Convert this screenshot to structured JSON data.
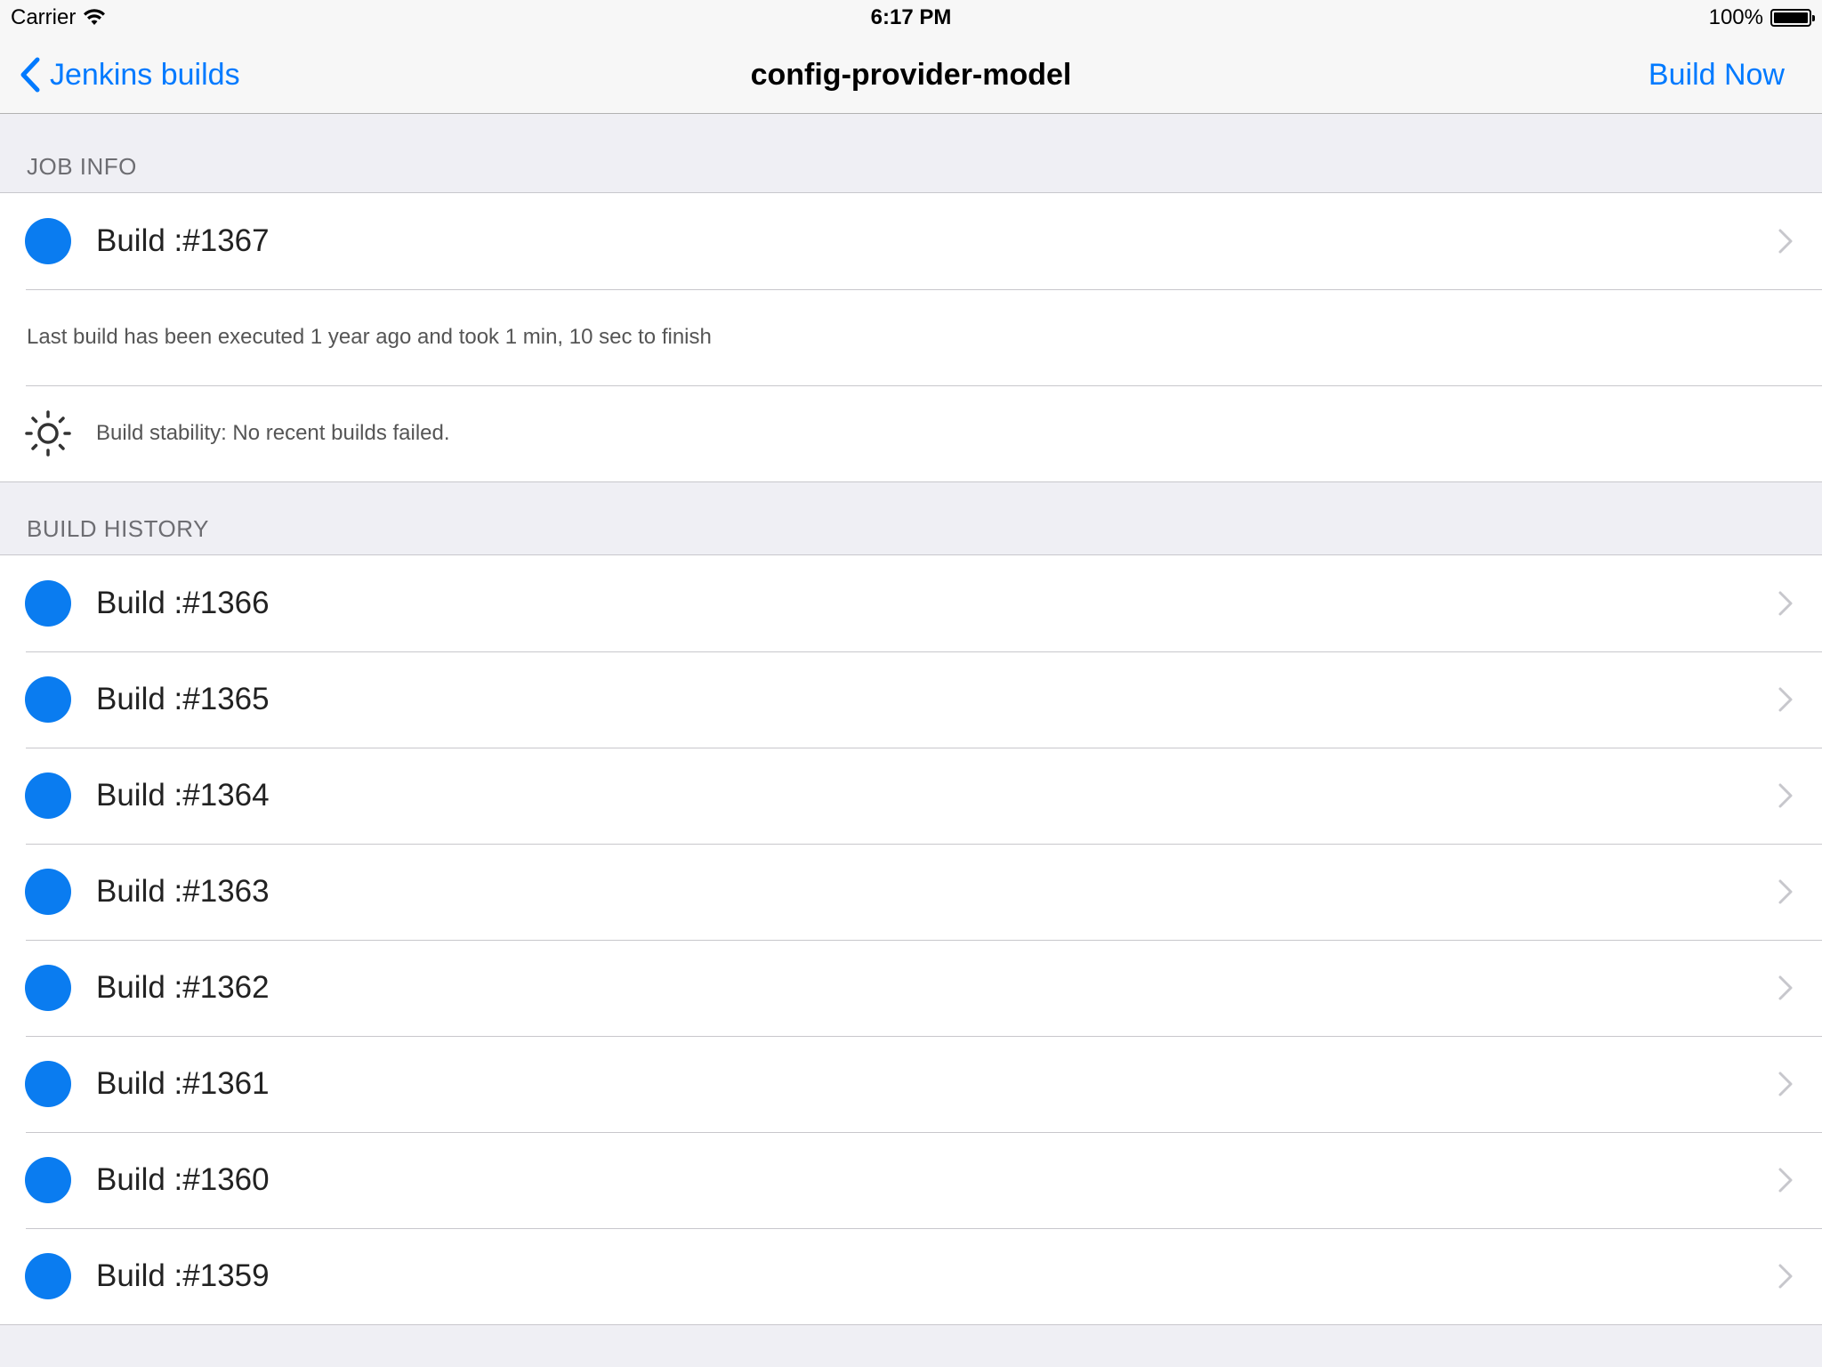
{
  "status_bar": {
    "carrier": "Carrier",
    "time": "6:17 PM",
    "battery": "100%",
    "battery_level": 1.0
  },
  "nav": {
    "back_label": "Jenkins builds",
    "title": "config-provider-model",
    "action_label": "Build Now",
    "tint_color": "#007aff"
  },
  "job_info": {
    "header": "JOB INFO",
    "last_build": {
      "label": "Build :#1367",
      "status_color": "#0a7cf0"
    },
    "summary": "Last build has been executed 1 year ago and took 1 min, 10 sec to finish",
    "stability": {
      "icon": "sun-icon",
      "text": "Build stability: No recent builds failed."
    }
  },
  "build_history": {
    "header": "BUILD HISTORY",
    "items": [
      {
        "label": "Build :#1366",
        "status_color": "#0a7cf0"
      },
      {
        "label": "Build :#1365",
        "status_color": "#0a7cf0"
      },
      {
        "label": "Build :#1364",
        "status_color": "#0a7cf0"
      },
      {
        "label": "Build :#1363",
        "status_color": "#0a7cf0"
      },
      {
        "label": "Build :#1362",
        "status_color": "#0a7cf0"
      },
      {
        "label": "Build :#1361",
        "status_color": "#0a7cf0"
      },
      {
        "label": "Build :#1360",
        "status_color": "#0a7cf0"
      },
      {
        "label": "Build :#1359",
        "status_color": "#0a7cf0"
      }
    ]
  }
}
